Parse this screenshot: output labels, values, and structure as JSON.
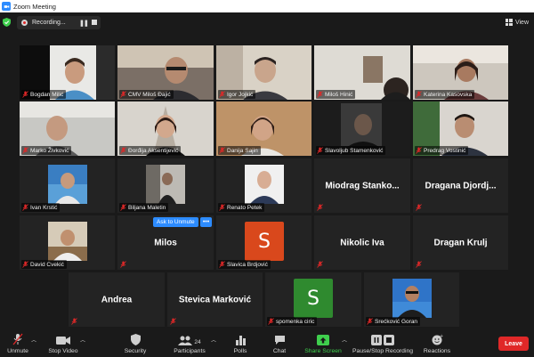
{
  "window": {
    "title": "Zoom Meeting"
  },
  "topbar": {
    "recording_label": "Recording...",
    "view_label": "View"
  },
  "tiles": [
    {
      "name": "Bogdan Milić"
    },
    {
      "name": "CMV Miloš Đajić"
    },
    {
      "name": "Igor Jojkić"
    },
    {
      "name": "Miloš Hinić"
    },
    {
      "name": "Katerina Kasovska"
    },
    {
      "name": "Marko Živković"
    },
    {
      "name": "Đorđija Aksentijević"
    },
    {
      "name": "Danija Sajin"
    },
    {
      "name": "Slavoljub Stamenković"
    },
    {
      "name": "Predrag Vostinić"
    },
    {
      "name": "Ivan Krstić"
    },
    {
      "name": "Biljana Maletin"
    },
    {
      "name": "Renato Petek"
    },
    {
      "big_name": "Miodrag Stanko..."
    },
    {
      "big_name": "Dragana Djordj..."
    },
    {
      "name": "David Cvekić"
    },
    {
      "big_name": "Milos"
    },
    {
      "name": "Slavica Brdjović",
      "initial": "S"
    },
    {
      "big_name": "Nikolic Iva"
    },
    {
      "big_name": "Dragan Krulj"
    },
    {
      "big_name": "Andrea"
    },
    {
      "big_name": "Stevica Marković"
    },
    {
      "name": "spomenka ciric",
      "initial": "S"
    },
    {
      "name": "Srećković Goran"
    }
  ],
  "overlay": {
    "ask_to_unmute": "Ask to Unmute",
    "more": "•••"
  },
  "toolbar": {
    "unmute": "Unmute",
    "stop_video": "Stop Video",
    "security": "Security",
    "participants": "Participants",
    "participants_count": "24",
    "polls": "Polls",
    "chat": "Chat",
    "share_screen": "Share Screen",
    "pause_stop_recording": "Pause/Stop Recording",
    "reactions": "Reactions",
    "leave": "Leave"
  },
  "colors": {
    "accent": "#2d8cff",
    "active_speaker": "#b8e22f",
    "leave": "#e02828",
    "share_green": "#3fcf4d",
    "avatar_orange": "#d9481c",
    "avatar_green": "#2f8a2f"
  }
}
